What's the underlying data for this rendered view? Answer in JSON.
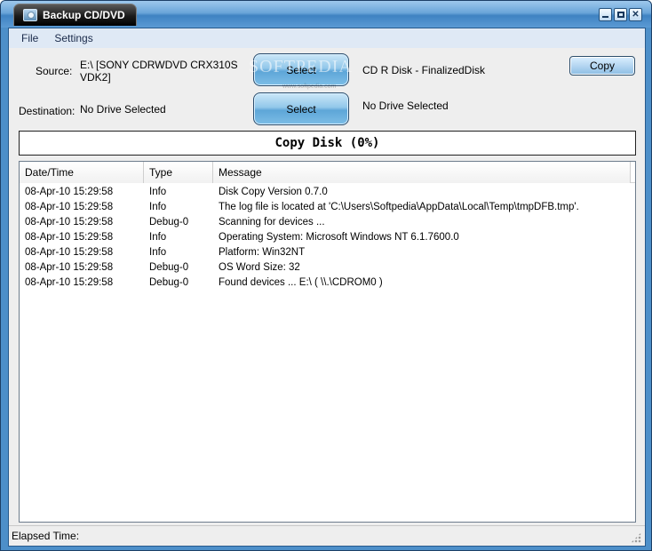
{
  "window": {
    "title": "Backup CD/DVD"
  },
  "menu": {
    "items": [
      "File",
      "Settings"
    ]
  },
  "source": {
    "label": "Source:",
    "drive": "E:\\ [SONY     CDRWDVD CRX310S VDK2]",
    "select_label": "Select",
    "disk_info": "CD R Disk - FinalizedDisk"
  },
  "destination": {
    "label": "Destination:",
    "drive": "No Drive Selected",
    "select_label": "Select",
    "disk_info": "No Drive Selected"
  },
  "copy_button": {
    "label": "Copy"
  },
  "progress": {
    "text": "Copy Disk (0%)",
    "percent": 0
  },
  "watermark": {
    "text": "SOFTPEDIA",
    "subtext": "www.softpedia.com"
  },
  "log": {
    "columns": [
      "Date/Time",
      "Type",
      "Message"
    ],
    "rows": [
      {
        "datetime": "08-Apr-10 15:29:58",
        "type": "Info",
        "message": "Disk Copy Version 0.7.0"
      },
      {
        "datetime": "08-Apr-10 15:29:58",
        "type": "Info",
        "message": "The log file is located at 'C:\\Users\\Softpedia\\AppData\\Local\\Temp\\tmpDFB.tmp'."
      },
      {
        "datetime": "08-Apr-10 15:29:58",
        "type": "Debug-0",
        "message": "Scanning for devices ..."
      },
      {
        "datetime": "08-Apr-10 15:29:58",
        "type": "Info",
        "message": "Operating System: Microsoft Windows NT 6.1.7600.0"
      },
      {
        "datetime": "08-Apr-10 15:29:58",
        "type": "Info",
        "message": "Platform: Win32NT"
      },
      {
        "datetime": "08-Apr-10 15:29:58",
        "type": "Debug-0",
        "message": "OS Word Size: 32"
      },
      {
        "datetime": "08-Apr-10 15:29:58",
        "type": "Debug-0",
        "message": "Found devices ... E:\\ ( \\\\.\\CDROM0 )"
      }
    ]
  },
  "status": {
    "elapsed_label": "Elapsed Time:"
  }
}
